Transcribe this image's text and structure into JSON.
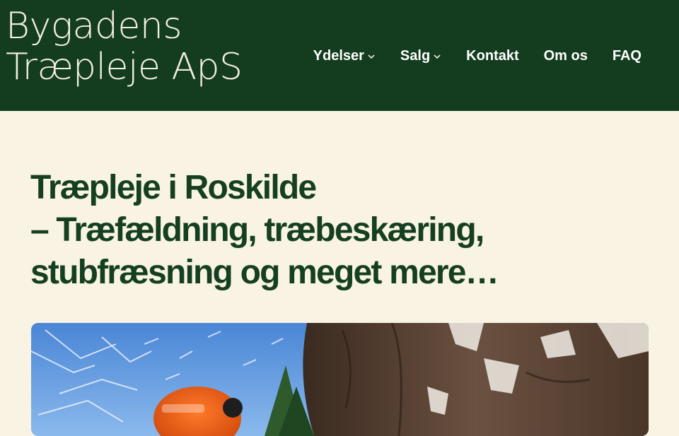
{
  "header": {
    "logo_line1": "Bygadens",
    "logo_line2": "Træpleje ApS",
    "nav": [
      {
        "label": "Ydelser",
        "has_dropdown": true,
        "icon": "chevron-down-icon"
      },
      {
        "label": "Salg",
        "has_dropdown": true,
        "icon": "chevron-down-icon"
      },
      {
        "label": "Kontakt",
        "has_dropdown": false
      },
      {
        "label": "Om os",
        "has_dropdown": false
      },
      {
        "label": "FAQ",
        "has_dropdown": false
      }
    ]
  },
  "hero": {
    "title_line1": "Træpleje i Roskilde",
    "title_line2": "– Træfældning, træbeskæring,",
    "title_line3": "stubfræsning og meget mere…"
  },
  "colors": {
    "header_bg": "#133d1e",
    "page_bg": "#f8f3e3",
    "title_text": "#153f20",
    "nav_text": "#ffffff"
  }
}
